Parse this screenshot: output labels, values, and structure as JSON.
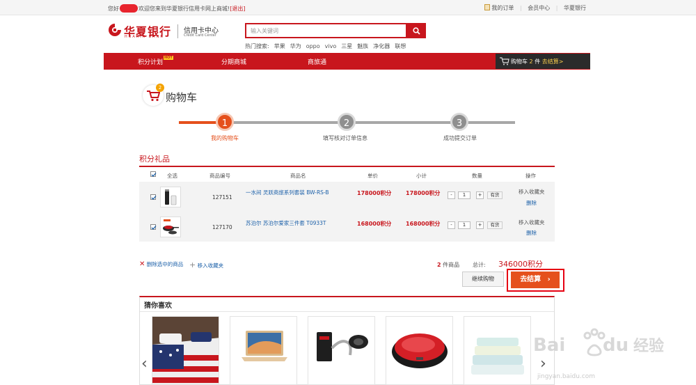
{
  "topbar": {
    "greeting_pre": "您好",
    "greeting_post": "欢迎您来到华夏银行信用卡网上商城!",
    "logout": "[退出]",
    "my_orders": "我的订单",
    "member_center": "会员中心",
    "bank_link": "华夏银行",
    "sep": "|"
  },
  "logo": {
    "bank_cn": "华夏银行",
    "bank_en": "HUAXIA BANK",
    "center_cn": "信用卡中心",
    "center_en": "Credit Card Center"
  },
  "search": {
    "placeholder": "输入关键词",
    "hot_label": "热门搜索:",
    "hot_terms": [
      "苹果",
      "华为",
      "oppo",
      "vivo",
      "三星",
      "魅族",
      "净化器",
      "联想"
    ]
  },
  "nav": {
    "items": [
      "积分计划",
      "分期商城",
      "商旅通"
    ],
    "hot_badge": "HOT",
    "cart_label": "购物车",
    "cart_count": "2",
    "cart_unit": "件",
    "cart_go": "去结算>"
  },
  "cart": {
    "title": "购物车",
    "badge": "2"
  },
  "steps": [
    {
      "num": "1",
      "label": "我的购物车"
    },
    {
      "num": "2",
      "label": "填写核对订单信息"
    },
    {
      "num": "3",
      "label": "成功提交订单"
    }
  ],
  "section": {
    "title": "积分礼品",
    "headers": [
      "全选",
      "商品编号",
      "商品名",
      "单价",
      "小计",
      "数量",
      "操作"
    ]
  },
  "items": [
    {
      "code": "127151",
      "name": "一水间 灵跃商旅系列套装 BW-RS-B",
      "price": "178000积分",
      "subtotal": "178000积分",
      "qty": "1",
      "stock": "有货",
      "fav": "移入收藏夹",
      "del": "删除"
    },
    {
      "code": "127170",
      "name": "苏泊尔 苏泊尔爱家三件套 T0933T",
      "price": "168000积分",
      "subtotal": "168000积分",
      "qty": "1",
      "stock": "有货",
      "fav": "移入收藏夹",
      "del": "删除"
    }
  ],
  "qty_minus": "-",
  "qty_plus": "+",
  "footer": {
    "delete_selected": "删除选中的商品",
    "move_fav": "移入收藏夹",
    "count": "2",
    "count_label": "件商品",
    "total_label": "总计:",
    "total_value": "346000积分",
    "continue": "继续购物",
    "checkout": "去结算"
  },
  "guess": {
    "title": "猜你喜欢"
  },
  "watermark": {
    "text": "Bai du 经验",
    "url": "jingyan.baidu.com"
  },
  "colors": {
    "brand_red": "#c8161d",
    "checkout_orange": "#e5501c",
    "link_blue": "#1a5fa8",
    "step_active": "#e5501c",
    "step_inactive": "#9a9a9a"
  }
}
